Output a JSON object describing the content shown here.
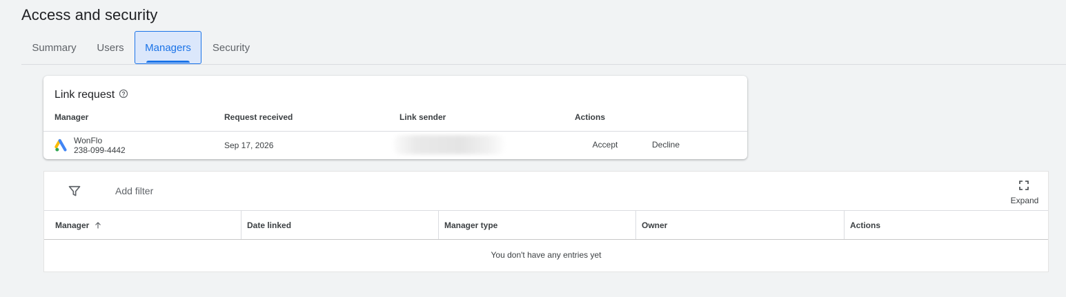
{
  "page": {
    "title": "Access and security"
  },
  "tabs": [
    {
      "label": "Summary",
      "active": false
    },
    {
      "label": "Users",
      "active": false
    },
    {
      "label": "Managers",
      "active": true
    },
    {
      "label": "Security",
      "active": false
    }
  ],
  "link_request": {
    "title": "Link request",
    "help_icon": "help-circle-icon",
    "columns": [
      "Manager",
      "Request received",
      "Link sender",
      "Actions"
    ],
    "row": {
      "manager_name": "WonFlo",
      "manager_id": "238-099-4442",
      "logo_icon": "google-ads-logo-icon",
      "request_received": "Sep 17, 2026",
      "accept_label": "Accept",
      "decline_label": "Decline"
    }
  },
  "managers_table": {
    "filter_icon": "funnel-icon",
    "add_filter_label": "Add filter",
    "expand_icon": "fullscreen-icon",
    "expand_label": "Expand",
    "columns": [
      "Manager",
      "Date linked",
      "Manager type",
      "Owner",
      "Actions"
    ],
    "sort_icon": "arrow-up-icon",
    "empty_message": "You don't have any entries yet"
  },
  "colors": {
    "accent": "#1a73e8",
    "active_tab_bg": "#dbe7fb",
    "page_bg": "#f1f3f4"
  }
}
